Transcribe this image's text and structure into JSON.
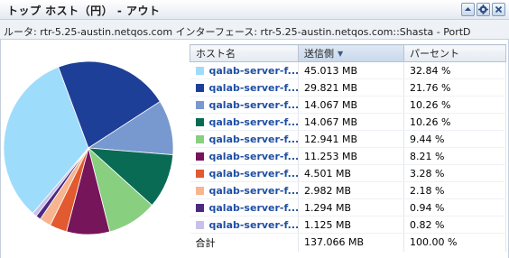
{
  "header": {
    "title": "トップ ホスト（円） - アウト",
    "buttons": [
      {
        "icon": "collapse-up-icon"
      },
      {
        "icon": "settings-gear-icon"
      },
      {
        "icon": "close-icon"
      }
    ]
  },
  "subtitle": "ルータ: rtr-5.25-austin.netqos.com インターフェース: rtr-5.25-austin.netqos.com::Shasta - PortD",
  "table": {
    "columns": {
      "host": "ホスト名",
      "sent": "送信側",
      "percent": "パーセント"
    },
    "sort_indicator": "▼",
    "rows": [
      {
        "host": "qalab-server-f...",
        "sent": "45.013 MB",
        "percent": "32.84 %",
        "color": "#9edcfb"
      },
      {
        "host": "qalab-server-f...",
        "sent": "29.821 MB",
        "percent": "21.76 %",
        "color": "#1e3f97"
      },
      {
        "host": "qalab-server-f...",
        "sent": "14.067 MB",
        "percent": "10.26 %",
        "color": "#7899cf"
      },
      {
        "host": "qalab-server-f...",
        "sent": "14.067 MB",
        "percent": "10.26 %",
        "color": "#0a6b55"
      },
      {
        "host": "qalab-server-f...",
        "sent": "12.941 MB",
        "percent": "9.44 %",
        "color": "#88cf80"
      },
      {
        "host": "qalab-server-f...",
        "sent": "11.253 MB",
        "percent": "8.21 %",
        "color": "#76155a"
      },
      {
        "host": "qalab-server-f...",
        "sent": "4.501 MB",
        "percent": "3.28 %",
        "color": "#e25a30"
      },
      {
        "host": "qalab-server-f...",
        "sent": "2.982 MB",
        "percent": "2.18 %",
        "color": "#f7b48f"
      },
      {
        "host": "qalab-server-f...",
        "sent": "1.294 MB",
        "percent": "0.94 %",
        "color": "#4b2a80"
      },
      {
        "host": "qalab-server-f...",
        "sent": "1.125 MB",
        "percent": "0.82 %",
        "color": "#c9c0ea"
      }
    ],
    "total": {
      "label": "合計",
      "sent": "137.066 MB",
      "percent": "100.00 %"
    }
  },
  "chart_data": {
    "type": "pie",
    "categories": [
      "qalab-server-f...",
      "qalab-server-f...",
      "qalab-server-f...",
      "qalab-server-f...",
      "qalab-server-f...",
      "qalab-server-f...",
      "qalab-server-f...",
      "qalab-server-f...",
      "qalab-server-f...",
      "qalab-server-f..."
    ],
    "values": [
      32.84,
      21.76,
      10.26,
      10.26,
      9.44,
      8.21,
      3.28,
      2.18,
      0.94,
      0.82
    ],
    "colors": [
      "#9edcfb",
      "#1e3f97",
      "#7899cf",
      "#0a6b55",
      "#88cf80",
      "#76155a",
      "#e25a30",
      "#f7b48f",
      "#4b2a80",
      "#c9c0ea"
    ],
    "title": ""
  }
}
